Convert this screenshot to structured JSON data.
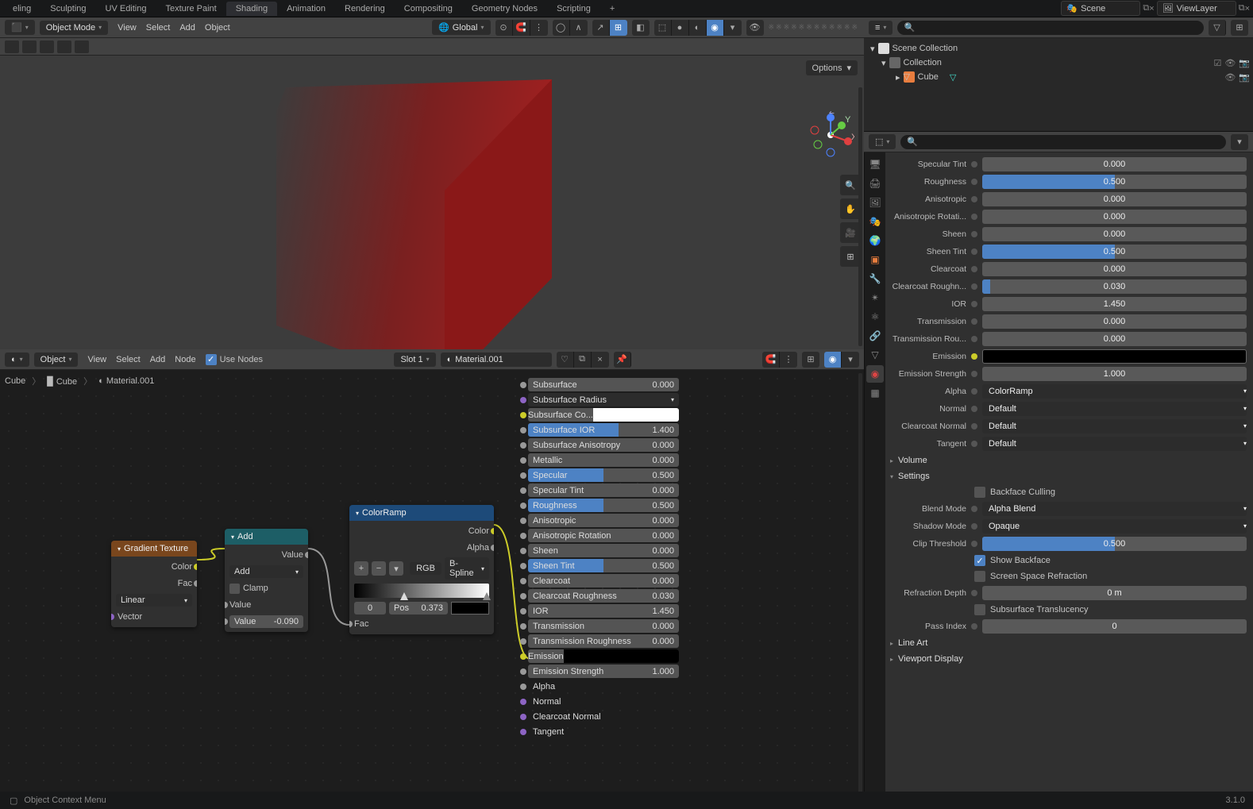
{
  "tabs": {
    "items": [
      "eling",
      "Sculpting",
      "UV Editing",
      "Texture Paint",
      "Shading",
      "Animation",
      "Rendering",
      "Compositing",
      "Geometry Nodes",
      "Scripting"
    ],
    "active": 4
  },
  "scene_field": "Scene",
  "viewlayer_field": "ViewLayer",
  "vp_header": {
    "mode": "Object Mode",
    "menus": [
      "View",
      "Select",
      "Add",
      "Object"
    ],
    "orientation": "Global",
    "options": "Options"
  },
  "node_header": {
    "type": "Object",
    "menus": [
      "View",
      "Select",
      "Add",
      "Node"
    ],
    "use_nodes": "Use Nodes",
    "slot": "Slot 1",
    "material": "Material.001"
  },
  "breadcrumb": [
    "Cube",
    "Cube",
    "Material.001"
  ],
  "outliner": {
    "root": "Scene Collection",
    "coll": "Collection",
    "obj": "Cube"
  },
  "nodes": {
    "grad": {
      "title": "Gradient Texture",
      "out_color": "Color",
      "out_fac": "Fac",
      "type": "Linear",
      "in_vec": "Vector"
    },
    "add": {
      "title": "Add",
      "out_value": "Value",
      "op": "Add",
      "clamp": "Clamp",
      "in_value": "Value",
      "val": "Value",
      "valnum": "-0.090"
    },
    "ramp": {
      "title": "ColorRamp",
      "out_color": "Color",
      "out_alpha": "Alpha",
      "mode": "RGB",
      "interp": "B-Spline",
      "stop0": "0",
      "pos_lbl": "Pos",
      "pos": "0.373",
      "in_fac": "Fac"
    }
  },
  "bsdf": [
    {
      "k": "Subsurface",
      "v": "0.000",
      "sock": "#999"
    },
    {
      "k": "Subsurface Radius",
      "v": "",
      "sock": "#8d64c4",
      "drop": true
    },
    {
      "k": "Subsurface Co...",
      "v": "",
      "sock": "#cccc29",
      "color": "#ffffff"
    },
    {
      "k": "Subsurface IOR",
      "v": "1.400",
      "sock": "#999",
      "blue": 60
    },
    {
      "k": "Subsurface Anisotropy",
      "v": "0.000",
      "sock": "#999"
    },
    {
      "k": "Metallic",
      "v": "0.000",
      "sock": "#999"
    },
    {
      "k": "Specular",
      "v": "0.500",
      "sock": "#999",
      "blue": 50
    },
    {
      "k": "Specular Tint",
      "v": "0.000",
      "sock": "#999"
    },
    {
      "k": "Roughness",
      "v": "0.500",
      "sock": "#999",
      "blue": 50
    },
    {
      "k": "Anisotropic",
      "v": "0.000",
      "sock": "#999"
    },
    {
      "k": "Anisotropic Rotation",
      "v": "0.000",
      "sock": "#999"
    },
    {
      "k": "Sheen",
      "v": "0.000",
      "sock": "#999"
    },
    {
      "k": "Sheen Tint",
      "v": "0.500",
      "sock": "#999",
      "blue": 50
    },
    {
      "k": "Clearcoat",
      "v": "0.000",
      "sock": "#999"
    },
    {
      "k": "Clearcoat Roughness",
      "v": "0.030",
      "sock": "#999"
    },
    {
      "k": "IOR",
      "v": "1.450",
      "sock": "#999"
    },
    {
      "k": "Transmission",
      "v": "0.000",
      "sock": "#999"
    },
    {
      "k": "Transmission Roughness",
      "v": "0.000",
      "sock": "#999"
    },
    {
      "k": "Emission",
      "v": "",
      "sock": "#cccc29",
      "color": "#000000"
    },
    {
      "k": "Emission Strength",
      "v": "1.000",
      "sock": "#999"
    },
    {
      "k": "Alpha",
      "v": "",
      "sock": "#999",
      "plain": true
    },
    {
      "k": "Normal",
      "v": "",
      "sock": "#8d64c4",
      "plain": true
    },
    {
      "k": "Clearcoat Normal",
      "v": "",
      "sock": "#8d64c4",
      "plain": true
    },
    {
      "k": "Tangent",
      "v": "",
      "sock": "#8d64c4",
      "plain": true
    }
  ],
  "props": {
    "rows": [
      {
        "l": "Specular Tint",
        "v": "0.000",
        "f": 0
      },
      {
        "l": "Roughness",
        "v": "0.500",
        "f": 50
      },
      {
        "l": "Anisotropic",
        "v": "0.000",
        "f": 0
      },
      {
        "l": "Anisotropic Rotati...",
        "v": "0.000",
        "f": 0
      },
      {
        "l": "Sheen",
        "v": "0.000",
        "f": 0
      },
      {
        "l": "Sheen Tint",
        "v": "0.500",
        "f": 50
      },
      {
        "l": "Clearcoat",
        "v": "0.000",
        "f": 0
      },
      {
        "l": "Clearcoat Roughn...",
        "v": "0.030",
        "f": 3
      },
      {
        "l": "IOR",
        "v": "1.450",
        "f": 0
      },
      {
        "l": "Transmission",
        "v": "0.000",
        "f": 0
      },
      {
        "l": "Transmission Rou...",
        "v": "0.000",
        "f": 0
      }
    ],
    "emission": "Emission",
    "em_strength": {
      "l": "Emission Strength",
      "v": "1.000"
    },
    "alpha": {
      "l": "Alpha",
      "v": "ColorRamp"
    },
    "normal": {
      "l": "Normal",
      "v": "Default"
    },
    "cc_normal": {
      "l": "Clearcoat Normal",
      "v": "Default"
    },
    "tangent": {
      "l": "Tangent",
      "v": "Default"
    },
    "sec_volume": "Volume",
    "sec_settings": "Settings",
    "backface": "Backface Culling",
    "blend": {
      "l": "Blend Mode",
      "v": "Alpha Blend"
    },
    "shadow": {
      "l": "Shadow Mode",
      "v": "Opaque"
    },
    "clip": {
      "l": "Clip Threshold",
      "v": "0.500"
    },
    "show_backface": "Show Backface",
    "ssr": "Screen Space Refraction",
    "refr_depth": {
      "l": "Refraction Depth",
      "v": "0 m"
    },
    "translucency": "Subsurface Translucency",
    "pass": {
      "l": "Pass Index",
      "v": "0"
    },
    "sec_lineart": "Line Art",
    "sec_vpdisp": "Viewport Display"
  },
  "status": {
    "ctx": "Object Context Menu",
    "ver": "3.1.0"
  }
}
